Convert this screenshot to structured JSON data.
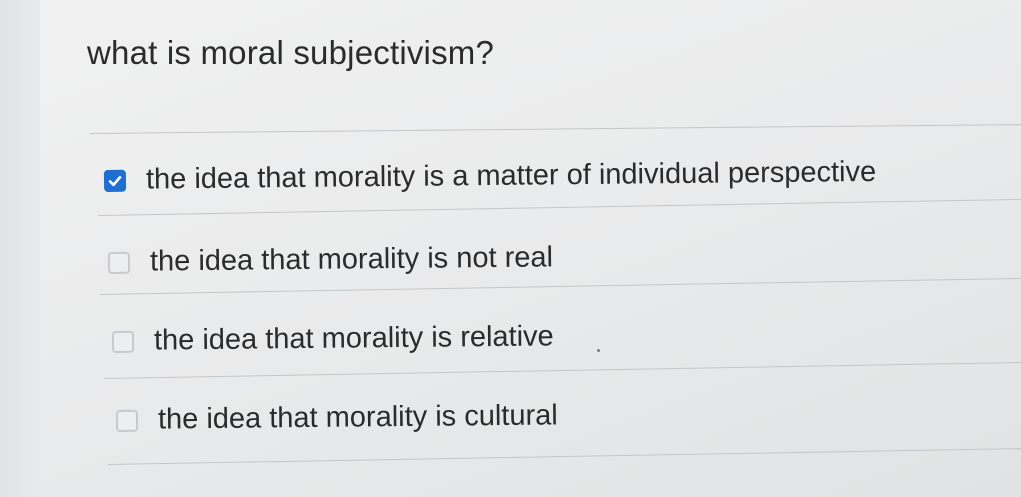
{
  "question": {
    "text": "what is moral subjectivism?"
  },
  "options": [
    {
      "label": "the idea that morality is a matter of individual perspective",
      "checked": true
    },
    {
      "label": "the idea that morality is not real",
      "checked": false
    },
    {
      "label": "the idea that morality is relative",
      "checked": false
    },
    {
      "label": "the idea that morality is cultural",
      "checked": false
    }
  ],
  "colors": {
    "checkbox_checked": "#1f6fd1",
    "text": "#2b2b2b"
  },
  "icons": {
    "checked": "checkmark-icon"
  }
}
